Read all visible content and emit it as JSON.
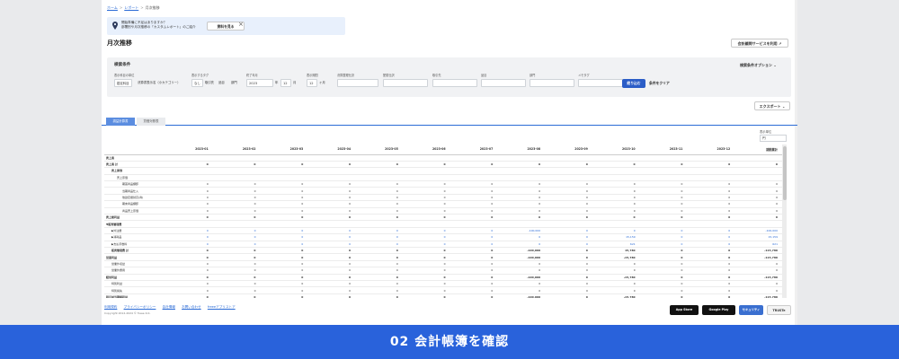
{
  "breadcrumb": [
    "ホーム",
    "レポート",
    "月次推移"
  ],
  "notice": {
    "line1": "開始準備に不足はありますか？",
    "line2": "部署別や月次推移の「カスタムレポート」のご紹介",
    "button": "資料を見る",
    "close": "×"
  },
  "title": "月次推移",
  "ext_button": "会計顧問サービスを利用",
  "filters": {
    "heading": "検索条件",
    "options": "検索条件オプション",
    "labels": [
      "表示科目の単位",
      "表示するタグ",
      "終了年月",
      "表示期間",
      "決算整理仕訳",
      "配賦仕訳",
      "取引先",
      "品目",
      "部門",
      "メモタグ"
    ],
    "unit_chips": [
      "勘定科目",
      "決算書表示名（小カテゴリー）"
    ],
    "tag_chips": [
      "なし",
      "取引先",
      "品目",
      "部門"
    ],
    "year": "2023",
    "year_unit": "年",
    "month": "12",
    "month_unit": "月",
    "period": "12",
    "period_unit": "ヶ月",
    "adj_value": "",
    "alloc_value": "",
    "search_button": "絞り込む",
    "clear_button": "条件をクリア"
  },
  "export_button": "エクスポート",
  "tabs": [
    "損益計算書",
    "貸借対照表"
  ],
  "unit_label": "表示単位",
  "unit_value": "円",
  "table": {
    "header": [
      "",
      "2023-01",
      "2023-02",
      "2023-03",
      "2023-04",
      "2023-05",
      "2023-06",
      "2023-07",
      "2023-08",
      "2023-09",
      "2023-10",
      "2023-11",
      "2023-12",
      "期間累計"
    ],
    "rows": [
      {
        "label": "売上高",
        "indent": 0,
        "bold": true,
        "values": []
      },
      {
        "label": "売上高 計",
        "indent": 0,
        "bold": true,
        "values": [
          "0",
          "0",
          "0",
          "0",
          "0",
          "0",
          "0",
          "0",
          "0",
          "0",
          "0",
          "0",
          "0"
        ]
      },
      {
        "label": "売上原価",
        "indent": 1,
        "bold": true,
        "values": []
      },
      {
        "label": "売上原価",
        "indent": 2,
        "bold": false,
        "values": []
      },
      {
        "label": "期首商品棚卸",
        "indent": 3,
        "bold": false,
        "values": [
          "0",
          "0",
          "0",
          "0",
          "0",
          "0",
          "0",
          "0",
          "0",
          "0",
          "0",
          "0",
          "0"
        ]
      },
      {
        "label": "当期商品仕入",
        "indent": 3,
        "bold": false,
        "values": [
          "0",
          "0",
          "0",
          "0",
          "0",
          "0",
          "0",
          "0",
          "0",
          "0",
          "0",
          "0",
          "0"
        ]
      },
      {
        "label": "他勘定振替高(商)",
        "indent": 3,
        "bold": false,
        "values": [
          "0",
          "0",
          "0",
          "0",
          "0",
          "0",
          "0",
          "0",
          "0",
          "0",
          "0",
          "0",
          "0"
        ]
      },
      {
        "label": "期末商品棚卸",
        "indent": 3,
        "bold": false,
        "values": [
          "0",
          "0",
          "0",
          "0",
          "0",
          "0",
          "0",
          "0",
          "0",
          "0",
          "0",
          "0",
          "0"
        ]
      },
      {
        "label": "商品売上原価",
        "indent": 3,
        "bold": false,
        "values": [
          "0",
          "0",
          "0",
          "0",
          "0",
          "0",
          "0",
          "0",
          "0",
          "0",
          "0",
          "0",
          "0"
        ]
      },
      {
        "label": "売上総利益",
        "indent": 0,
        "bold": true,
        "sum": true,
        "values": [
          "0",
          "0",
          "0",
          "0",
          "0",
          "0",
          "0",
          "0",
          "0",
          "0",
          "0",
          "0",
          "0"
        ]
      },
      {
        "label": "▼販売管理費",
        "indent": 0,
        "bold": true,
        "values": []
      },
      {
        "label": "▶外注費",
        "indent": 1,
        "bold": false,
        "blue": true,
        "values": [
          "0",
          "0",
          "0",
          "0",
          "0",
          "0",
          "0",
          "-100,000",
          "0",
          "0",
          "0",
          "0",
          "-100,000"
        ]
      },
      {
        "label": "▶消耗品",
        "indent": 1,
        "bold": false,
        "blue": true,
        "values": [
          "0",
          "0",
          "0",
          "0",
          "0",
          "0",
          "0",
          "0",
          "0",
          "15,159",
          "0",
          "0",
          "15,159"
        ]
      },
      {
        "label": "▶支払手数料",
        "indent": 1,
        "bold": false,
        "blue": true,
        "values": [
          "0",
          "0",
          "0",
          "0",
          "0",
          "0",
          "0",
          "0",
          "0",
          "621",
          "0",
          "0",
          "621"
        ]
      },
      {
        "label": "販売管理費 計",
        "indent": 1,
        "bold": true,
        "sum": true,
        "values": [
          "0",
          "0",
          "0",
          "0",
          "0",
          "0",
          "0",
          "-100,000",
          "0",
          "15,780",
          "0",
          "0",
          "-115,780"
        ]
      },
      {
        "label": "営業利益",
        "indent": 0,
        "bold": true,
        "sum": true,
        "values": [
          "0",
          "0",
          "0",
          "0",
          "0",
          "0",
          "0",
          "-100,000",
          "0",
          "-15,780",
          "0",
          "0",
          "-115,780"
        ]
      },
      {
        "label": "営業外収益",
        "indent": 1,
        "bold": false,
        "values": [
          "0",
          "0",
          "0",
          "0",
          "0",
          "0",
          "0",
          "0",
          "0",
          "0",
          "0",
          "0",
          "0"
        ]
      },
      {
        "label": "営業外費用",
        "indent": 1,
        "bold": false,
        "values": [
          "0",
          "0",
          "0",
          "0",
          "0",
          "0",
          "0",
          "0",
          "0",
          "0",
          "0",
          "0",
          "0"
        ]
      },
      {
        "label": "経常利益",
        "indent": 0,
        "bold": true,
        "sum": true,
        "values": [
          "0",
          "0",
          "0",
          "0",
          "0",
          "0",
          "0",
          "-100,000",
          "0",
          "-15,780",
          "0",
          "0",
          "-115,780"
        ]
      },
      {
        "label": "特別利益",
        "indent": 1,
        "bold": false,
        "values": [
          "0",
          "0",
          "0",
          "0",
          "0",
          "0",
          "0",
          "0",
          "0",
          "0",
          "0",
          "0",
          "0"
        ]
      },
      {
        "label": "特別損失",
        "indent": 1,
        "bold": false,
        "values": [
          "0",
          "0",
          "0",
          "0",
          "0",
          "0",
          "0",
          "0",
          "0",
          "0",
          "0",
          "0",
          "0"
        ]
      },
      {
        "label": "税引前当期純利益",
        "indent": 0,
        "bold": true,
        "sum": true,
        "values": [
          "0",
          "0",
          "0",
          "0",
          "0",
          "0",
          "0",
          "-100,000",
          "0",
          "-15,780",
          "0",
          "0",
          "-115,780"
        ]
      }
    ]
  },
  "footer": {
    "links": [
      "利用規約",
      "プライバシーポリシー",
      "会社情報",
      "お問い合わせ",
      "freeeアプリストア"
    ],
    "copyright": "Copyright 2012-2024 © freee K.K.",
    "badges": [
      "App Store",
      "Google Play",
      "セキュリティ",
      "TRUSTe"
    ]
  },
  "banner": "02 会計帳簿を確認",
  "colors": {
    "accent": "#2b6bd6",
    "banner": "#2962db",
    "button": "#2b5dc7"
  }
}
